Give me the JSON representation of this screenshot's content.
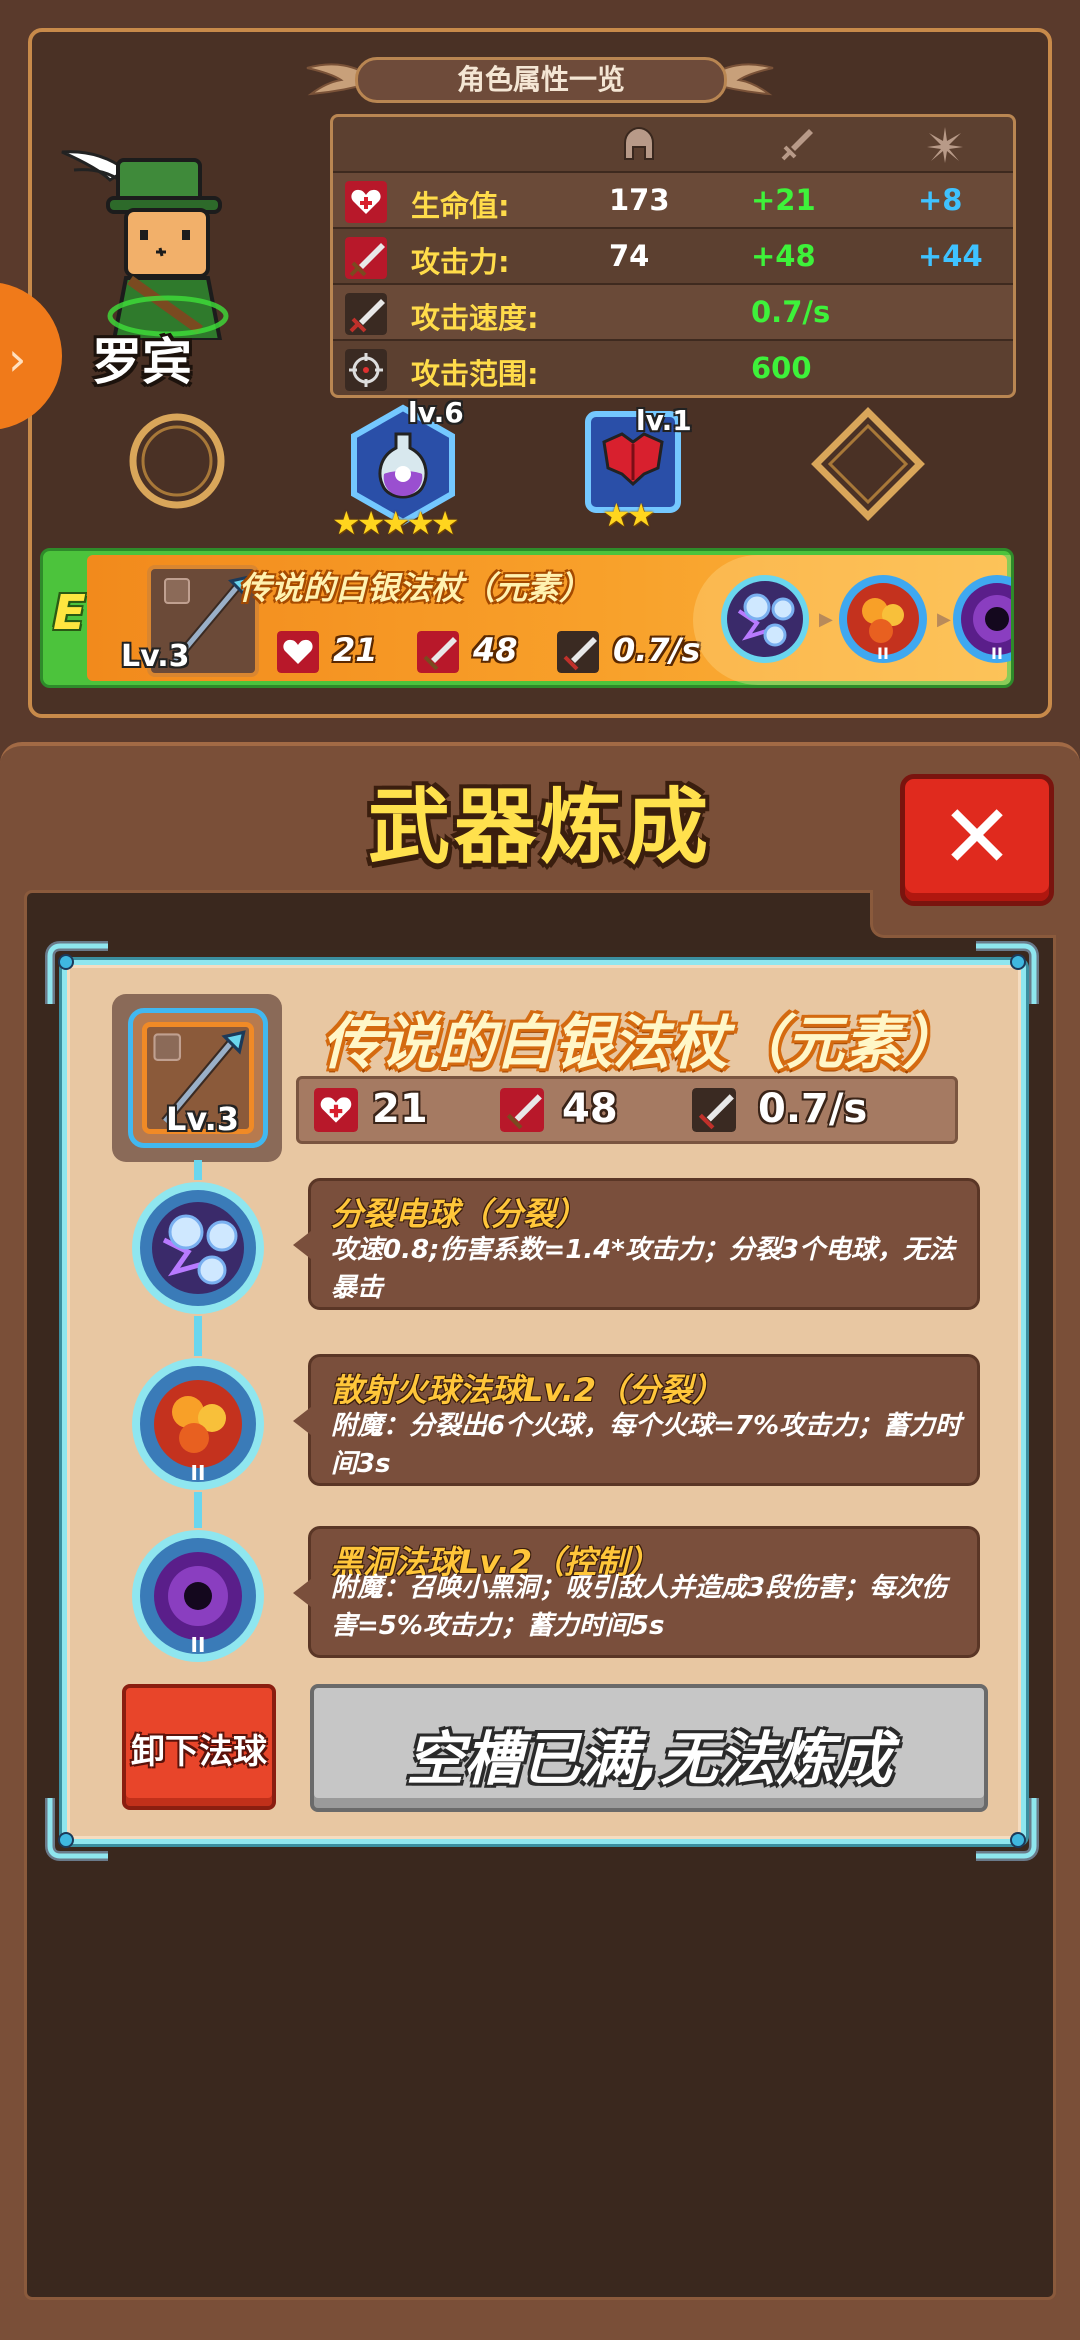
{
  "panel": {
    "title": "角色属性一览",
    "character_name": "罗宾",
    "stats_header_icons": [
      "helmet-icon",
      "sword-icon",
      "sparkle-icon"
    ],
    "stats": [
      {
        "icon": "heart-icon",
        "label": "生命值:",
        "base": "173",
        "equip": "+21",
        "extra": "+8"
      },
      {
        "icon": "attack-icon",
        "label": "攻击力:",
        "base": "74",
        "equip": "+48",
        "extra": "+44"
      },
      {
        "icon": "sword-speed-icon",
        "label": "攻击速度:",
        "base": "",
        "equip": "0.7/s",
        "extra": ""
      },
      {
        "icon": "crosshair-icon",
        "label": "攻击范围:",
        "base": "",
        "equip": "600",
        "extra": ""
      }
    ],
    "slots": [
      {
        "name": "empty-slot",
        "level": "",
        "stars": ""
      },
      {
        "name": "potion-slot",
        "level": "lv.6",
        "stars": "★★★★★"
      },
      {
        "name": "armor-slot",
        "level": "lv.1",
        "stars": "★★"
      },
      {
        "name": "empty-diamond-slot",
        "level": "",
        "stars": ""
      }
    ],
    "weapon_bar": {
      "grade": "E",
      "level": "Lv.3",
      "name": "传说的白银法杖（元素）",
      "hp": "21",
      "atk": "48",
      "speed": "0.7/s",
      "orbs": [
        "lightning-orb",
        "fire-orb",
        "blackhole-orb"
      ]
    }
  },
  "refine": {
    "title": "武器炼成",
    "weapon": {
      "name": "传说的白银法杖（元素）",
      "level": "Lv.3",
      "hp": "21",
      "atk": "48",
      "speed": "0.7/s"
    },
    "skills": [
      {
        "name": "分裂电球（分裂）",
        "desc": "攻速0.8;伤害系数=1.4*攻击力；分裂3个电球，无法暴击",
        "orb": "lightning-orb"
      },
      {
        "name": "散射火球法球Lv.2（分裂）",
        "desc": "附魔：分裂出6个火球，每个火球=7%攻击力；蓄力时间3s",
        "orb": "fire-orb"
      },
      {
        "name": "黑洞法球Lv.2（控制）",
        "desc": "附魔：召唤小黑洞；吸引敌人并造成3段伤害；每次伤害=5%攻击力；蓄力时间5s",
        "orb": "blackhole-orb"
      }
    ],
    "unequip_label": "卸下法球",
    "full_label": "空槽已满,无法炼成"
  },
  "colors": {
    "accent_yellow": "#ffdc4a",
    "equip_green": "#3ef23a",
    "extra_blue": "#3fc2ff",
    "close_red": "#e02a1e"
  }
}
